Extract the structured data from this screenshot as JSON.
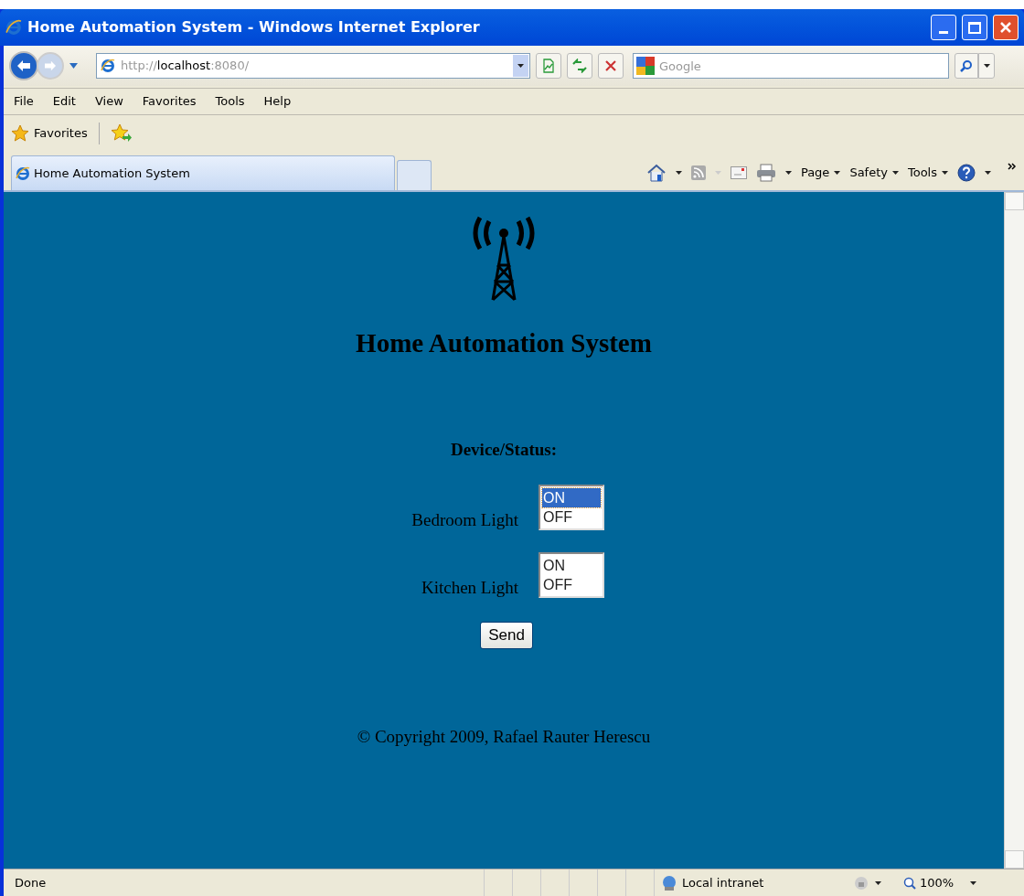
{
  "window": {
    "title": "Home Automation System - Windows Internet Explorer"
  },
  "address": {
    "scheme": "http://",
    "host": "localhost",
    "rest": ":8080/"
  },
  "search": {
    "placeholder": "Google"
  },
  "menu": [
    "File",
    "Edit",
    "View",
    "Favorites",
    "Tools",
    "Help"
  ],
  "favorites_bar": {
    "label": "Favorites"
  },
  "tabs": [
    {
      "label": "Home Automation System",
      "selected": true
    }
  ],
  "command_bar": [
    "Page",
    "Safety",
    "Tools"
  ],
  "page": {
    "title": "Home Automation System",
    "section": "Device/Status:",
    "devices": [
      {
        "name": "Bedroom Light",
        "options": [
          {
            "label": "ON",
            "selected": true
          },
          {
            "label": "OFF",
            "selected": false
          }
        ]
      },
      {
        "name": "Kitchen Light",
        "options": [
          {
            "label": "ON",
            "selected": false
          },
          {
            "label": "OFF",
            "selected": false
          }
        ]
      }
    ],
    "button": "Send",
    "footer": "© Copyright 2009, Rafael Rauter Herescu"
  },
  "status_bar": {
    "text": "Done",
    "zone": "Local intranet",
    "zoom": "100%"
  }
}
